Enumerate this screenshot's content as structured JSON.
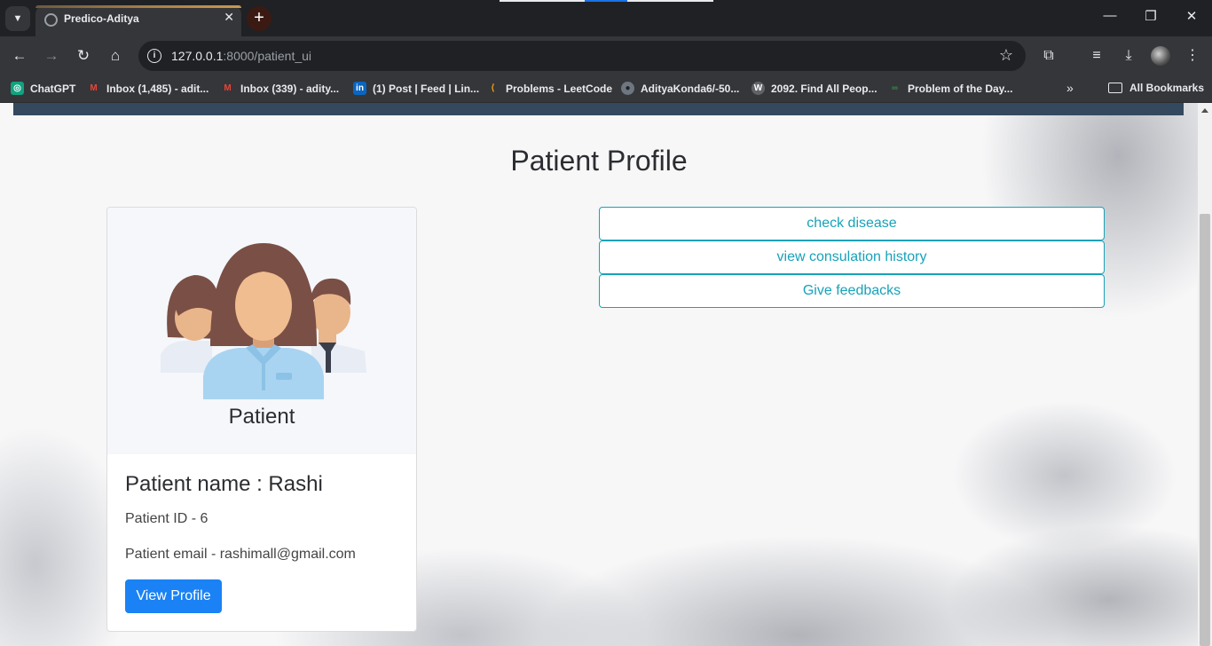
{
  "browser": {
    "tab_title": "Predico-Aditya",
    "tab_close": "✕",
    "new_tab": "+",
    "url_host": "127.0.0.1",
    "url_path": ":8000/patient_ui",
    "window_controls": [
      "—",
      "❐",
      "✕"
    ]
  },
  "bookmarks": {
    "items": [
      {
        "label": "ChatGPT",
        "icon": "chatgpt-icon",
        "color": "#10a37f",
        "glyph": "◎"
      },
      {
        "label": "Inbox (1,485) - adit...",
        "icon": "gmail-icon",
        "color": "#ea4335",
        "glyph": "M"
      },
      {
        "label": "Inbox (339) - adity...",
        "icon": "gmail-icon",
        "color": "#ea4335",
        "glyph": "M"
      },
      {
        "label": "(1) Post | Feed | Lin...",
        "icon": "linkedin-icon",
        "color": "#0a66c2",
        "glyph": "in"
      },
      {
        "label": "Problems - LeetCode",
        "icon": "leetcode-icon",
        "color": "#ffa116",
        "glyph": "⟨"
      },
      {
        "label": "AdityaKonda6/-50...",
        "icon": "github-icon",
        "color": "#6e7681",
        "glyph": "●"
      },
      {
        "label": "2092. Find All Peop...",
        "icon": "site-icon",
        "color": "#5f6368",
        "glyph": "W"
      },
      {
        "label": "Problem of the Day...",
        "icon": "gfg-icon",
        "color": "#2f8d46",
        "glyph": "∞"
      }
    ],
    "more": "»",
    "all_bookmarks": "All Bookmarks"
  },
  "page": {
    "title": "Patient Profile",
    "card": {
      "image_caption": "Patient",
      "name_line": "Patient name : Rashi",
      "id_line": "Patient ID - 6",
      "email_line": "Patient email - rashimall@gmail.com",
      "button": "View Profile"
    },
    "actions": [
      "check disease",
      "view consulation history",
      "Give feedbacks"
    ]
  },
  "colors": {
    "accent_teal": "#17a2b8",
    "primary_blue": "#1a82f5",
    "navbar": "#34495e"
  }
}
